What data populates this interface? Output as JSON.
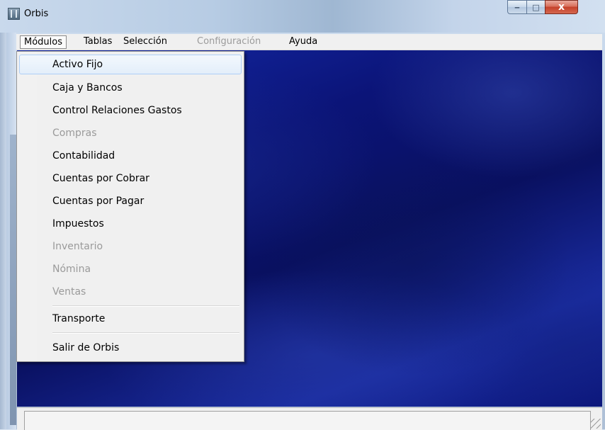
{
  "window": {
    "title": "Orbis",
    "minimize_glyph": "‒",
    "maximize_glyph": "□",
    "close_glyph": "x"
  },
  "menubar": {
    "modulos": "Módulos",
    "tablas": "Tablas",
    "seleccion": "Selección",
    "configuracion": "Configuración",
    "ayuda": "Ayuda"
  },
  "dropdown": {
    "items": [
      {
        "label": "Activo Fijo",
        "enabled": true,
        "highlighted": true
      },
      {
        "label": "Caja y Bancos",
        "enabled": true
      },
      {
        "label": "Control Relaciones Gastos",
        "enabled": true
      },
      {
        "label": "Compras",
        "enabled": false
      },
      {
        "label": "Contabilidad",
        "enabled": true
      },
      {
        "label": "Cuentas por Cobrar",
        "enabled": true
      },
      {
        "label": "Cuentas por Pagar",
        "enabled": true
      },
      {
        "label": "Impuestos",
        "enabled": true
      },
      {
        "label": "Inventario",
        "enabled": false
      },
      {
        "label": "Nómina",
        "enabled": false
      },
      {
        "label": "Ventas",
        "enabled": false
      },
      {
        "label": "Transporte",
        "enabled": true
      },
      {
        "label": "Salir de Orbis",
        "enabled": true
      }
    ]
  },
  "colors": {
    "client_background": "#0b1478",
    "disabled_text": "#9a9a9a",
    "highlight_border": "#aecff7",
    "close_button": "#c4412a"
  },
  "icons": {
    "app": "orbis-app-icon",
    "minimize": "minimize-icon",
    "maximize": "maximize-icon",
    "close": "close-icon",
    "resize": "resize-grip-icon"
  }
}
